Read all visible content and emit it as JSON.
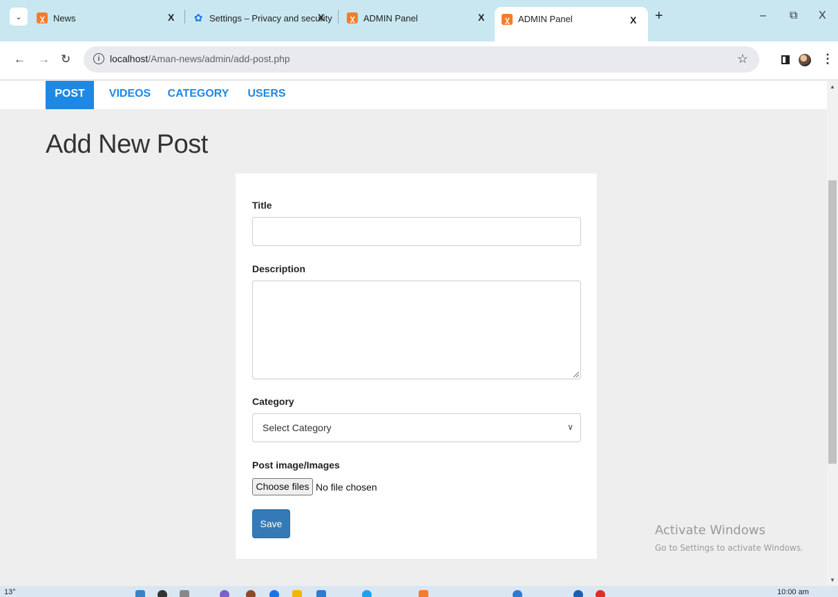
{
  "browser": {
    "tabs": [
      {
        "title": "News",
        "icon": "xampp-icon",
        "close": "X"
      },
      {
        "title": "Settings – Privacy and security",
        "icon": "gear-icon",
        "close": "X"
      },
      {
        "title": "ADMIN Panel",
        "icon": "xampp-icon",
        "close": "X"
      },
      {
        "title": "ADMIN Panel",
        "icon": "xampp-icon",
        "close": "X",
        "active": true
      }
    ],
    "new_tab": "+",
    "controls": {
      "minimize": "–",
      "restore": "⧉",
      "close": "X"
    },
    "url_host": "localhost",
    "url_path": "/Aman-news/admin/add-post.php"
  },
  "nav": {
    "items": [
      "POST",
      "VIDEOS",
      "CATEGORY",
      "USERS"
    ],
    "active": "POST"
  },
  "page": {
    "title": "Add New Post"
  },
  "form": {
    "title_label": "Title",
    "title_value": "",
    "description_label": "Description",
    "category_label": "Category",
    "category_selected": "Select Category",
    "images_label": "Post image/Images",
    "file_button": "Choose files",
    "file_status": "No file chosen",
    "save_label": "Save"
  },
  "watermark": {
    "line1": "Activate Windows",
    "line2": "Go to Settings to activate Windows."
  },
  "taskbar": {
    "weather": "13°",
    "clock": "10:00 am"
  },
  "colors": {
    "accent": "#1e88e5",
    "save_button": "#337ab7",
    "tab_strip": "#c8e7f1",
    "page_bg": "#eeeeee"
  }
}
